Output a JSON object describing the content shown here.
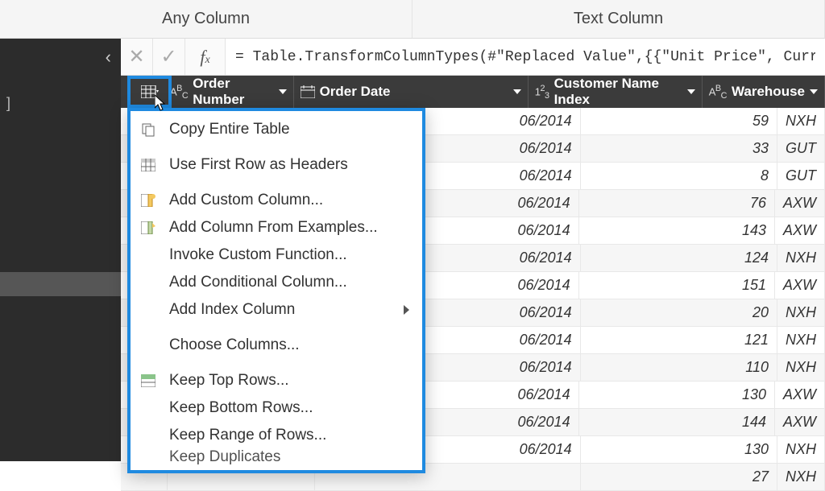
{
  "ribbon": {
    "any_column": "Any Column",
    "text_column": "Text Column"
  },
  "formula_bar": {
    "formula": "= Table.TransformColumnTypes(#\"Replaced Value\",{{\"Unit Price\", Curr"
  },
  "columns": {
    "order_number": {
      "label": "Order Number",
      "type": "ABC"
    },
    "order_date": {
      "label": "Order Date",
      "type": "date"
    },
    "customer_index": {
      "label": "Customer Name Index",
      "type": "123"
    },
    "warehouse": {
      "label": "Warehouse",
      "type": "ABC"
    }
  },
  "rows": [
    {
      "date": "06/2014",
      "cust": "59",
      "wh": "NXH"
    },
    {
      "date": "06/2014",
      "cust": "33",
      "wh": "GUT"
    },
    {
      "date": "06/2014",
      "cust": "8",
      "wh": "GUT"
    },
    {
      "date": "06/2014",
      "cust": "76",
      "wh": "AXW"
    },
    {
      "date": "06/2014",
      "cust": "143",
      "wh": "AXW"
    },
    {
      "date": "06/2014",
      "cust": "124",
      "wh": "NXH"
    },
    {
      "date": "06/2014",
      "cust": "151",
      "wh": "AXW"
    },
    {
      "date": "06/2014",
      "cust": "20",
      "wh": "NXH"
    },
    {
      "date": "06/2014",
      "cust": "121",
      "wh": "NXH"
    },
    {
      "date": "06/2014",
      "cust": "110",
      "wh": "NXH"
    },
    {
      "date": "06/2014",
      "cust": "130",
      "wh": "AXW"
    },
    {
      "date": "06/2014",
      "cust": "144",
      "wh": "AXW"
    },
    {
      "date": "06/2014",
      "cust": "130",
      "wh": "NXH"
    },
    {
      "date": "",
      "cust": "27",
      "wh": "NXH"
    }
  ],
  "context_menu": {
    "copy_table": "Copy Entire Table",
    "first_row_headers": "Use First Row as Headers",
    "add_custom_col": "Add Custom Column...",
    "add_col_examples": "Add Column From Examples...",
    "invoke_custom_fn": "Invoke Custom Function...",
    "add_conditional": "Add Conditional Column...",
    "add_index": "Add Index Column",
    "choose_columns": "Choose Columns...",
    "keep_top": "Keep Top Rows...",
    "keep_bottom": "Keep Bottom Rows...",
    "keep_range": "Keep Range of Rows...",
    "keep_dup": "Keep Duplicates"
  },
  "sidebar": {
    "bracket": "]"
  }
}
